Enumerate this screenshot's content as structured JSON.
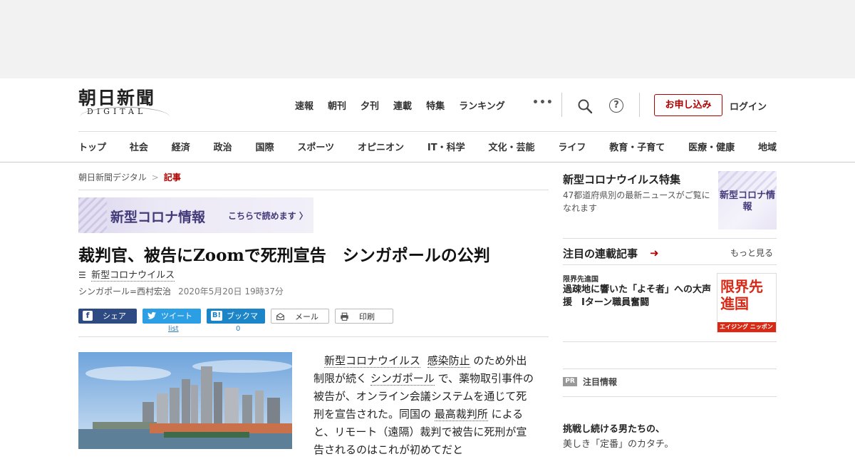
{
  "header": {
    "logo_main": "朝日新聞",
    "logo_sub": "DIGITAL",
    "top_nav": [
      "速報",
      "朝刊",
      "夕刊",
      "連載",
      "特集",
      "ランキング"
    ],
    "more": "•••",
    "help": "?",
    "subscribe": "お申し込み",
    "login": "ログイン"
  },
  "categories": [
    "トップ",
    "社会",
    "経済",
    "政治",
    "国際",
    "スポーツ",
    "オピニオン",
    "IT・科学",
    "文化・芸能",
    "ライフ",
    "教育・子育て",
    "医療・健康",
    "地域"
  ],
  "breadcrumb": {
    "home": "朝日新聞デジタル",
    "separator": ">",
    "current": "記事"
  },
  "banner": {
    "title": "新型コロナ情報",
    "cta": "こちらで読めます 〉"
  },
  "article": {
    "title": "裁判官、被告にZoomで死刑宣告　シンガポールの公判",
    "tag": "新型コロナウイルス",
    "byline": "シンガポール=西村宏治",
    "date": "2020年5月20日 19時37分",
    "share": {
      "facebook": "シェア",
      "twitter": "ツイート",
      "hatena_icon": "B!",
      "hatena": "ブックマーク",
      "mail": "メール",
      "print": "印刷",
      "twitter_count": "list",
      "hatena_count": "0"
    },
    "body": {
      "indent": "　",
      "link1": "新型コロナウイルス",
      "link2": "感染防止",
      "t1": "のため外出制限が続く",
      "link3": "シンガポール",
      "t2": "で、薬物取引事件の被告が、オンライン会議システムを通じて死刑を宣告された。同国の",
      "link4": "最高裁判所",
      "t3": "によると、リモート（遠隔）裁判で被告に死刑が宣告されるのはこれが初めてだと"
    }
  },
  "sidebar": {
    "feature": {
      "title": "新型コロナウイルス特集",
      "desc": "47都道府県別の最新ニュースがご覧になれます",
      "thumb": "新型コロナ情報"
    },
    "serial": {
      "title": "注目の連載記事",
      "arrow": "➜",
      "more": "もっと見る",
      "label": "限界先進国",
      "headline": "過疎地に響いた「よそ者」への大声援　Iターン職員奮闘",
      "thumb_title": "限界先進国",
      "thumb_bar": "エイジング ニッポン"
    },
    "pr": {
      "badge": "PR",
      "title": "注目情報",
      "headline": "挑戦し続ける男たちの、",
      "sub": "美しき「定番」のカタチ。"
    }
  }
}
